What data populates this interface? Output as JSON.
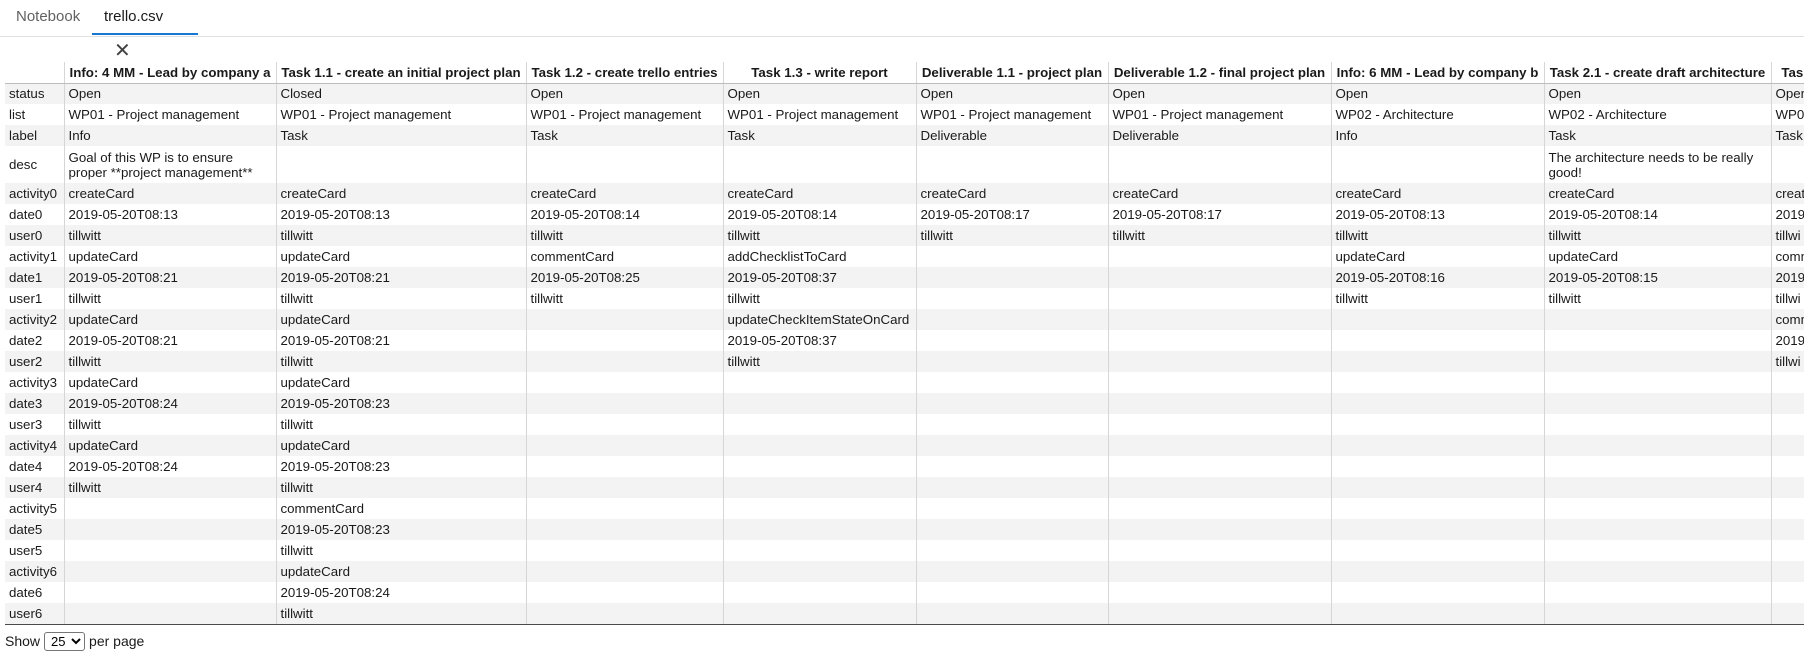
{
  "tabs": [
    {
      "label": "Notebook",
      "active": false
    },
    {
      "label": "trello.csv",
      "active": true
    }
  ],
  "grid": {
    "columns": [
      "",
      "Info: 4 MM - Lead by company a",
      "Task 1.1 - create an initial project plan",
      "Task 1.2 - create trello entries",
      "Task 1.3 - write report",
      "Deliverable 1.1 - project plan",
      "Deliverable 1.2 - final project plan",
      "Info: 6 MM - Lead by company b",
      "Task 2.1 - create draft architecture",
      "Task"
    ],
    "rows": [
      [
        "status",
        "Open",
        "Closed",
        "Open",
        "Open",
        "Open",
        "Open",
        "Open",
        "Open",
        "Oper"
      ],
      [
        "list",
        "WP01 - Project management",
        "WP01 - Project management",
        "WP01 - Project management",
        "WP01 - Project management",
        "WP01 - Project management",
        "WP01 - Project management",
        "WP02 - Architecture",
        "WP02 - Architecture",
        "WP0"
      ],
      [
        "label",
        "Info",
        "Task",
        "Task",
        "Task",
        "Deliverable",
        "Deliverable",
        "Info",
        "Task",
        "Task"
      ],
      [
        "desc",
        "Goal of this WP is to ensure proper **project management**",
        "",
        "",
        "",
        "",
        "",
        "",
        "The architecture needs to be really good!",
        ""
      ],
      [
        "activity0",
        "createCard",
        "createCard",
        "createCard",
        "createCard",
        "createCard",
        "createCard",
        "createCard",
        "createCard",
        "creat"
      ],
      [
        "date0",
        "2019-05-20T08:13",
        "2019-05-20T08:13",
        "2019-05-20T08:14",
        "2019-05-20T08:14",
        "2019-05-20T08:17",
        "2019-05-20T08:17",
        "2019-05-20T08:13",
        "2019-05-20T08:14",
        "2019"
      ],
      [
        "user0",
        "tillwitt",
        "tillwitt",
        "tillwitt",
        "tillwitt",
        "tillwitt",
        "tillwitt",
        "tillwitt",
        "tillwitt",
        "tillwi"
      ],
      [
        "activity1",
        "updateCard",
        "updateCard",
        "commentCard",
        "addChecklistToCard",
        "",
        "",
        "updateCard",
        "updateCard",
        "comm"
      ],
      [
        "date1",
        "2019-05-20T08:21",
        "2019-05-20T08:21",
        "2019-05-20T08:25",
        "2019-05-20T08:37",
        "",
        "",
        "2019-05-20T08:16",
        "2019-05-20T08:15",
        "2019"
      ],
      [
        "user1",
        "tillwitt",
        "tillwitt",
        "tillwitt",
        "tillwitt",
        "",
        "",
        "tillwitt",
        "tillwitt",
        "tillwi"
      ],
      [
        "activity2",
        "updateCard",
        "updateCard",
        "",
        "updateCheckItemStateOnCard",
        "",
        "",
        "",
        "",
        "comm"
      ],
      [
        "date2",
        "2019-05-20T08:21",
        "2019-05-20T08:21",
        "",
        "2019-05-20T08:37",
        "",
        "",
        "",
        "",
        "2019"
      ],
      [
        "user2",
        "tillwitt",
        "tillwitt",
        "",
        "tillwitt",
        "",
        "",
        "",
        "",
        "tillwi"
      ],
      [
        "activity3",
        "updateCard",
        "updateCard",
        "",
        "",
        "",
        "",
        "",
        "",
        ""
      ],
      [
        "date3",
        "2019-05-20T08:24",
        "2019-05-20T08:23",
        "",
        "",
        "",
        "",
        "",
        "",
        ""
      ],
      [
        "user3",
        "tillwitt",
        "tillwitt",
        "",
        "",
        "",
        "",
        "",
        "",
        ""
      ],
      [
        "activity4",
        "updateCard",
        "updateCard",
        "",
        "",
        "",
        "",
        "",
        "",
        ""
      ],
      [
        "date4",
        "2019-05-20T08:24",
        "2019-05-20T08:23",
        "",
        "",
        "",
        "",
        "",
        "",
        ""
      ],
      [
        "user4",
        "tillwitt",
        "tillwitt",
        "",
        "",
        "",
        "",
        "",
        "",
        ""
      ],
      [
        "activity5",
        "",
        "commentCard",
        "",
        "",
        "",
        "",
        "",
        "",
        ""
      ],
      [
        "date5",
        "",
        "2019-05-20T08:23",
        "",
        "",
        "",
        "",
        "",
        "",
        ""
      ],
      [
        "user5",
        "",
        "tillwitt",
        "",
        "",
        "",
        "",
        "",
        "",
        ""
      ],
      [
        "activity6",
        "",
        "updateCard",
        "",
        "",
        "",
        "",
        "",
        "",
        ""
      ],
      [
        "date6",
        "",
        "2019-05-20T08:24",
        "",
        "",
        "",
        "",
        "",
        "",
        ""
      ],
      [
        "user6",
        "",
        "tillwitt",
        "",
        "",
        "",
        "",
        "",
        "",
        ""
      ]
    ]
  },
  "pager": {
    "show_label": "Show",
    "per_page_value": "25",
    "per_page_options": [
      "25"
    ],
    "per_page_label": "per page"
  }
}
